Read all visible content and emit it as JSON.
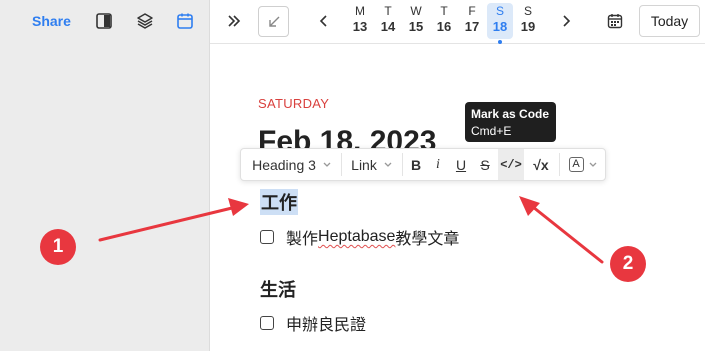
{
  "sidebar": {
    "share_label": "Share",
    "icons": [
      "panel-icon",
      "layers-icon",
      "calendar-icon"
    ]
  },
  "topbar": {
    "days": [
      {
        "name": "M",
        "date": "13",
        "active": false
      },
      {
        "name": "T",
        "date": "14",
        "active": false
      },
      {
        "name": "W",
        "date": "15",
        "active": false
      },
      {
        "name": "T",
        "date": "16",
        "active": false
      },
      {
        "name": "F",
        "date": "17",
        "active": false
      },
      {
        "name": "S",
        "date": "18",
        "active": true
      },
      {
        "name": "S",
        "date": "19",
        "active": false
      }
    ],
    "today_label": "Today"
  },
  "journal": {
    "weekday": "SATURDAY",
    "date_title": "Feb 18, 2023"
  },
  "toolbar": {
    "heading_label": "Heading 3",
    "link_label": "Link",
    "bold_label": "B",
    "italic_label": "i",
    "underline_label": "U",
    "strike_label": "S",
    "code_label": "</>",
    "math_label": "√x",
    "color_label": "A"
  },
  "tooltip": {
    "title": "Mark as Code",
    "shortcut": "Cmd+E"
  },
  "content": {
    "heading1": "工作",
    "todo1_prefix": "製作",
    "todo1_word": "Heptabase",
    "todo1_suffix": "教學文章",
    "heading2": "生活",
    "todo2": "申辦良民證"
  },
  "annotations": {
    "badge1": "1",
    "badge2": "2"
  },
  "colors": {
    "accent": "#2f7ef0",
    "weekday": "#d9413e",
    "annotation": "#e8373f",
    "selection": "#cddff5"
  }
}
